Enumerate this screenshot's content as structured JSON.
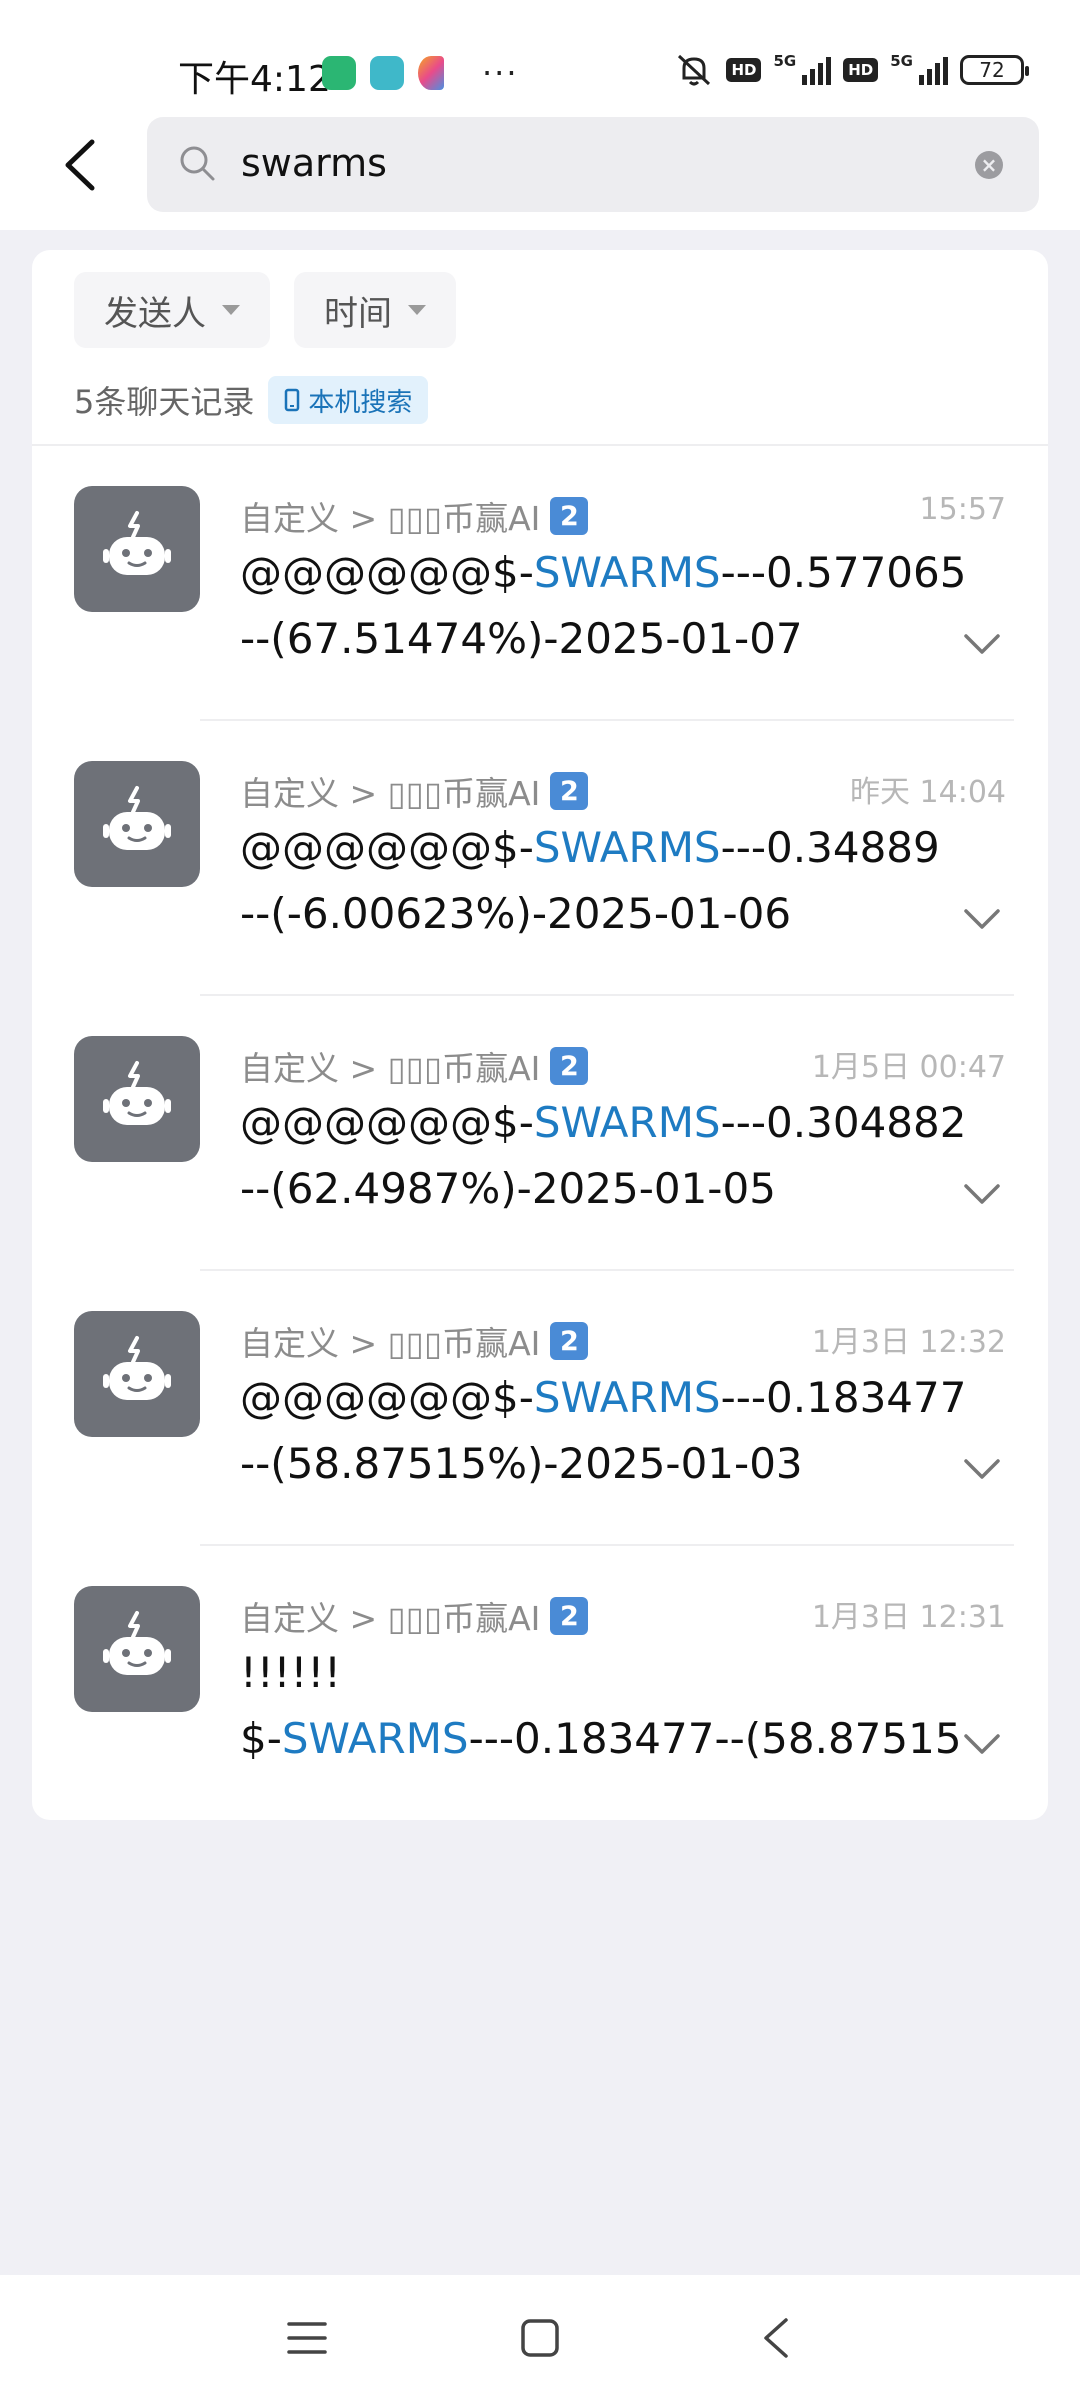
{
  "status_bar": {
    "time": "下午4:12",
    "more": "···",
    "network_1": "5G",
    "network_2": "5G",
    "hd_1": "HD",
    "hd_2": "HD",
    "battery": "72"
  },
  "header": {
    "search_query": "swarms",
    "clear_glyph": "×"
  },
  "filters": {
    "sender_label": "发送人",
    "time_label": "时间"
  },
  "summary": {
    "count_text": "5条聊天记录",
    "local_search_label": "本机搜索"
  },
  "results": [
    {
      "path": "自定义 > ▯▯▯币赢AI",
      "badge": "2",
      "time": "15:57",
      "line1_pre": "@@@@@@$-",
      "line1_hl": "SWARMS",
      "line1_post": "---0.577065",
      "line2": "--(67.51474%)-2025-01-07"
    },
    {
      "path": "自定义 > ▯▯▯币赢AI",
      "badge": "2",
      "time": "昨天 14:04",
      "line1_pre": "@@@@@@$-",
      "line1_hl": "SWARMS",
      "line1_post": "---0.34889",
      "line2": "--(-6.00623%)-2025-01-06"
    },
    {
      "path": "自定义 > ▯▯▯币赢AI",
      "badge": "2",
      "time": "1月5日 00:47",
      "line1_pre": "@@@@@@$-",
      "line1_hl": "SWARMS",
      "line1_post": "---0.304882",
      "line2": "--(62.4987%)-2025-01-05"
    },
    {
      "path": "自定义 > ▯▯▯币赢AI",
      "badge": "2",
      "time": "1月3日 12:32",
      "line1_pre": "@@@@@@$-",
      "line1_hl": "SWARMS",
      "line1_post": "---0.183477",
      "line2": "--(58.87515%)-2025-01-03"
    },
    {
      "path": "自定义 > ▯▯▯币赢AI",
      "badge": "2",
      "time": "1月3日 12:31",
      "line1_text": "!!!!!!",
      "line2_pre": "$-",
      "line2_hl": "SWARMS",
      "line2_post": "---0.183477--(58.87515"
    }
  ],
  "colors": {
    "accent_blue": "#1E7BC2",
    "avatar_gray": "#6E7178",
    "background": "#F0F0F5",
    "badge_blue": "#4A8BD6"
  },
  "icons": {
    "back": "back-arrow-icon",
    "search": "search-icon",
    "clear": "clear-icon",
    "caret": "caret-down-icon",
    "phone": "phone-icon",
    "avatar": "robot-icon",
    "expand": "chevron-down-icon",
    "nav_menu": "menu-icon",
    "nav_home": "home-icon",
    "nav_back": "nav-back-icon"
  }
}
